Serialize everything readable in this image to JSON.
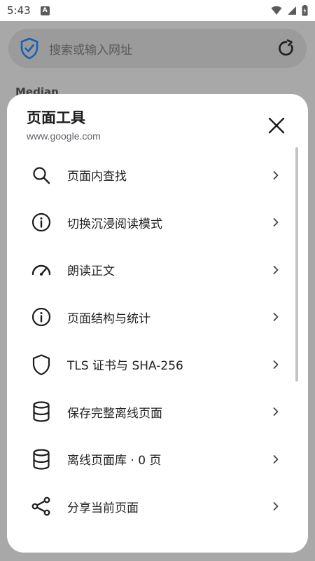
{
  "status_bar": {
    "time": "5:43",
    "notification_letter": "A"
  },
  "background": {
    "search_placeholder": "搜索或输入网址",
    "heading": "Median"
  },
  "sheet": {
    "title": "页面工具",
    "url": "www.google.com",
    "items": [
      {
        "label": "页面内查找",
        "icon": "search-icon"
      },
      {
        "label": "切换沉浸阅读模式",
        "icon": "info-icon"
      },
      {
        "label": "朗读正文",
        "icon": "gauge-icon"
      },
      {
        "label": "页面结构与统计",
        "icon": "info-icon"
      },
      {
        "label": "TLS 证书与 SHA-256",
        "icon": "shield-icon"
      },
      {
        "label": "保存完整离线页面",
        "icon": "database-icon"
      },
      {
        "label": "离线页面库 · 0 页",
        "icon": "database-icon"
      },
      {
        "label": "分享当前页面",
        "icon": "share-icon"
      }
    ]
  },
  "colors": {
    "scrim": "#a8a8a8",
    "sheet_bg": "#ffffff",
    "shield_blue": "#1a5fb4",
    "text_primary": "#222222",
    "text_secondary": "#5f6368"
  }
}
